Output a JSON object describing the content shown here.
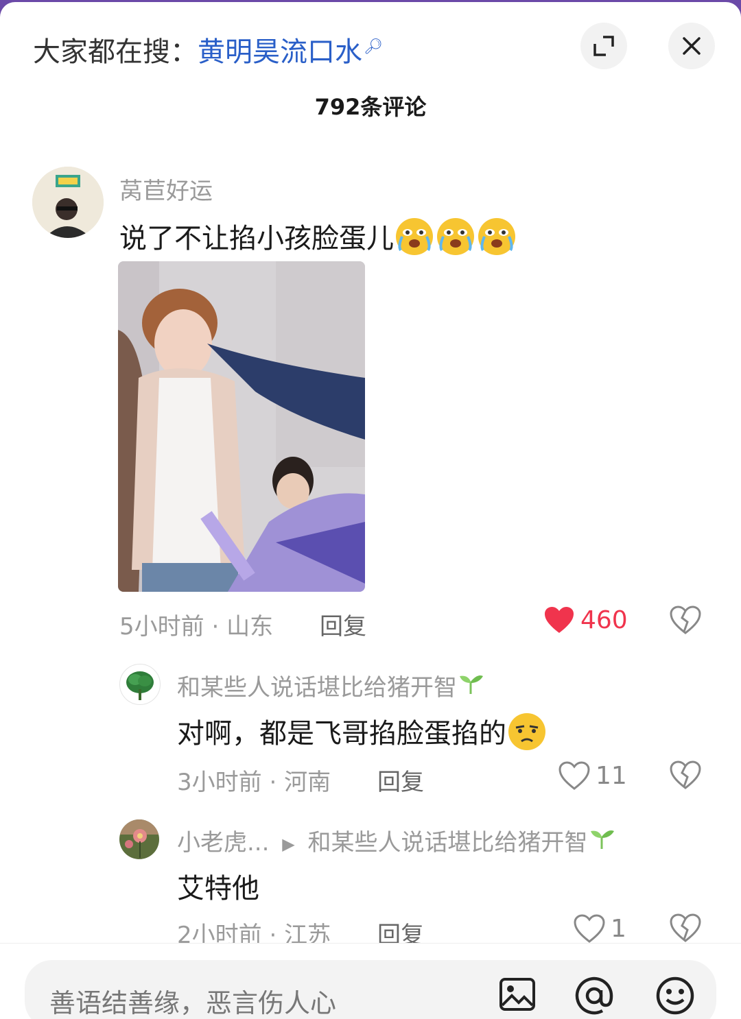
{
  "header": {
    "search_prefix": "大家都在搜：",
    "search_term": "黄明昊流口水",
    "comment_count": "792条评论"
  },
  "comments": [
    {
      "username": "莴苣好运",
      "text": "说了不让掐小孩脸蛋儿",
      "time": "5小时前",
      "location": "山东",
      "reply_label": "回复",
      "likes": "460",
      "liked": true
    }
  ],
  "replies": [
    {
      "username": "和某些人说话堪比给猪开智",
      "text": "对啊，都是飞哥掐脸蛋掐的",
      "time": "3小时前",
      "location": "河南",
      "reply_label": "回复",
      "likes": "11"
    },
    {
      "username": "小老虎...",
      "reply_to": "和某些人说话堪比给猪开智",
      "text": "艾特他",
      "time": "2小时前",
      "location": "江苏",
      "reply_label": "回复",
      "likes": "1"
    }
  ],
  "input": {
    "placeholder": "善语结善缘，恶言伤人心"
  },
  "colors": {
    "like_red": "#f0344d",
    "link_blue": "#2a5fc8",
    "meta_gray": "#9a9a9a"
  }
}
